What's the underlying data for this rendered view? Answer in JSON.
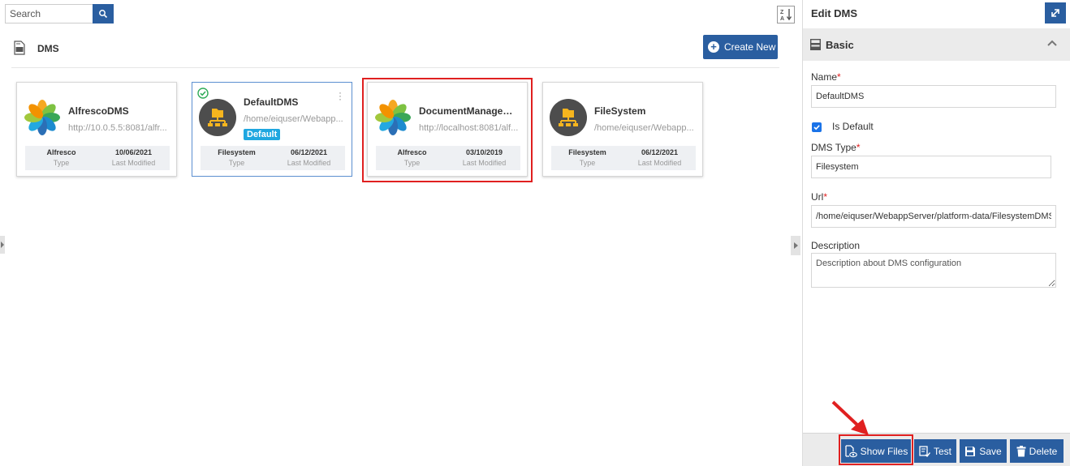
{
  "search": {
    "placeholder": "Search"
  },
  "header": {
    "title": "DMS",
    "create_label": "Create New"
  },
  "cards": [
    {
      "name": "AlfrescoDMS",
      "url": "http://10.0.5.5:8081/alfr...",
      "type": "Alfresco",
      "type_key": "Type",
      "date": "10/06/2021",
      "date_key": "Last Modified"
    },
    {
      "name": "DefaultDMS",
      "url": "/home/eiquser/Webapp...",
      "badge": "Default",
      "type": "Filesystem",
      "type_key": "Type",
      "date": "06/12/2021",
      "date_key": "Last Modified"
    },
    {
      "name": "DocumentManageme...",
      "url": "http://localhost:8081/alf...",
      "type": "Alfresco",
      "type_key": "Type",
      "date": "03/10/2019",
      "date_key": "Last Modified"
    },
    {
      "name": "FileSystem",
      "url": "/home/eiquser/Webapp...",
      "type": "Filesystem",
      "type_key": "Type",
      "date": "06/12/2021",
      "date_key": "Last Modified"
    }
  ],
  "panel": {
    "title": "Edit DMS",
    "section": "Basic",
    "name_label": "Name",
    "name_value": "DefaultDMS",
    "is_default_label": "Is Default",
    "type_label": "DMS Type",
    "type_value": "Filesystem",
    "url_label": "Url",
    "url_value": "/home/eiquser/WebappServer/platform-data/FilesystemDMS/",
    "desc_label": "Description",
    "desc_value": "Description about DMS configuration",
    "required_mark": "*"
  },
  "footer": {
    "show_files": "Show Files",
    "test": "Test",
    "save": "Save",
    "delete": "Delete"
  },
  "colors": {
    "primary": "#2a5ea0",
    "highlight": "#e02020",
    "badge": "#1fa7e0",
    "checkbox": "#1a73e8"
  }
}
